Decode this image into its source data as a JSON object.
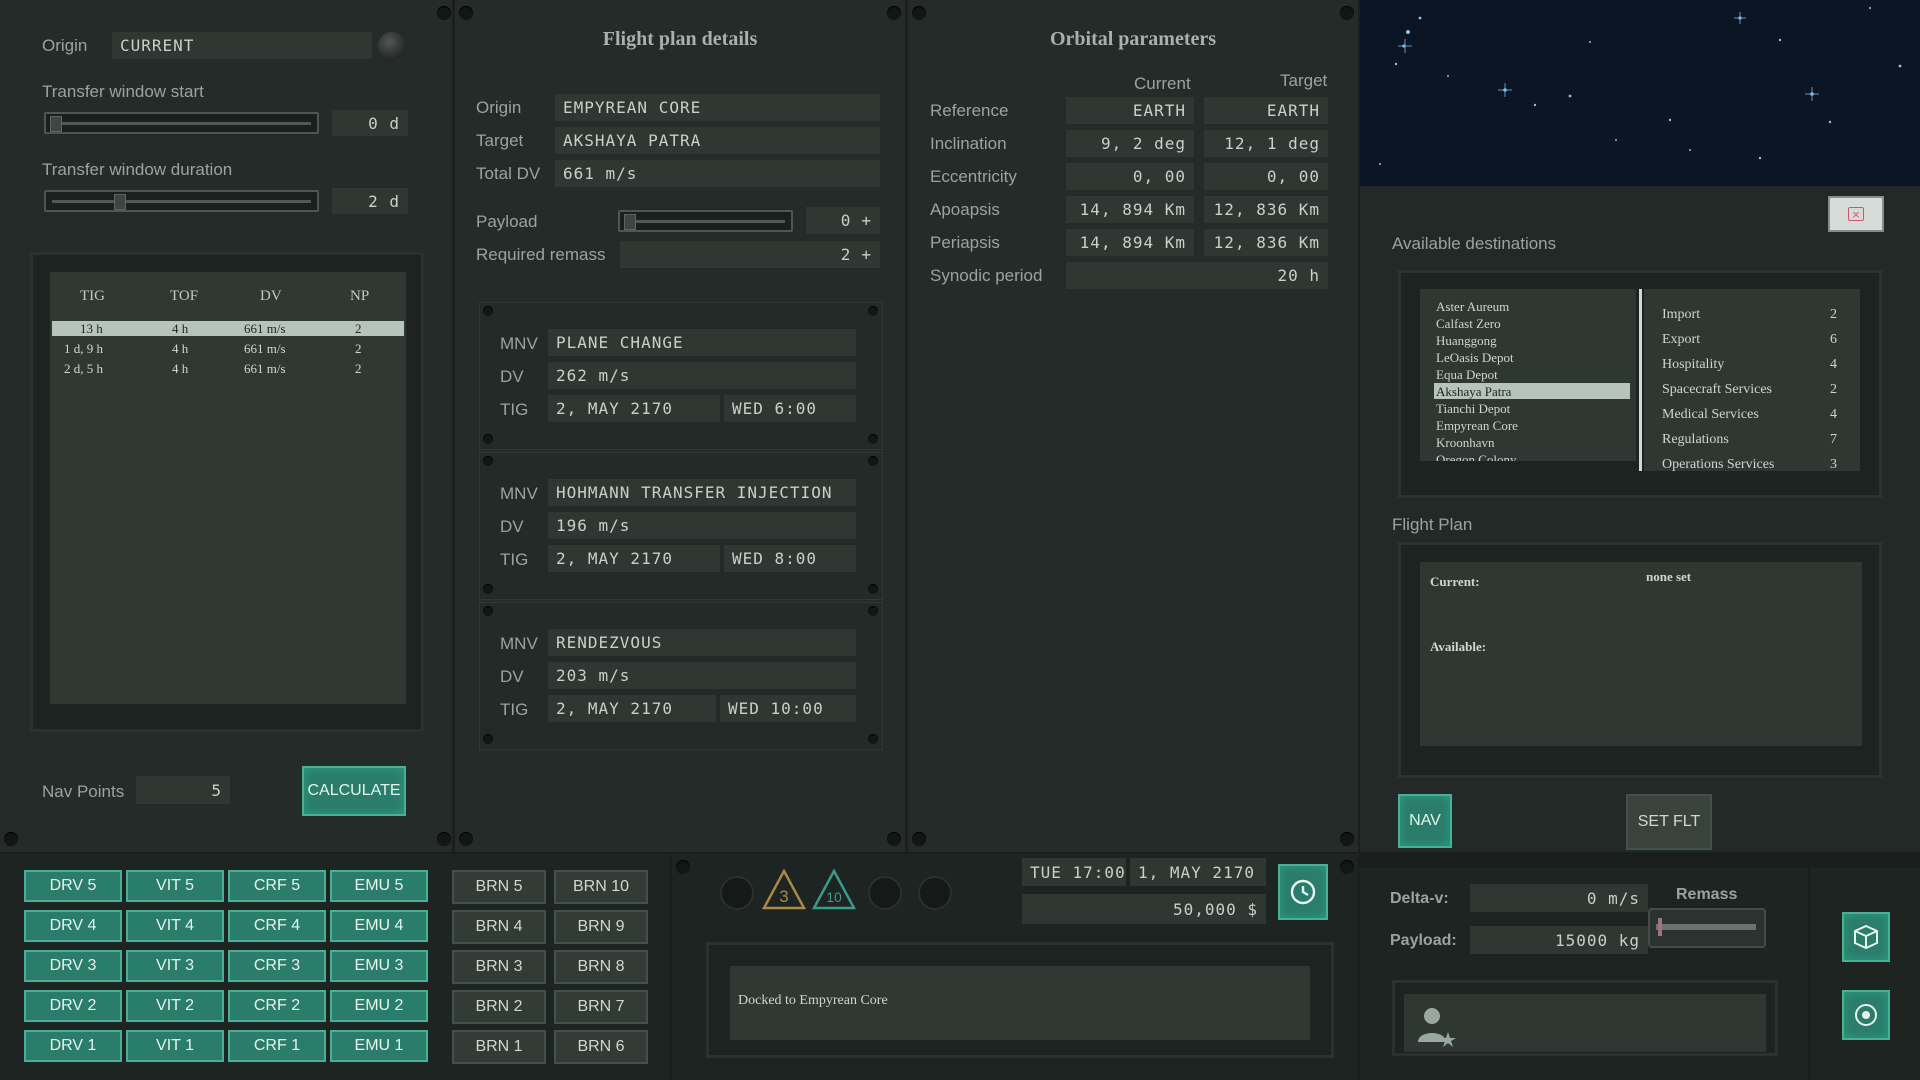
{
  "left": {
    "origin_label": "Origin",
    "origin_value": "CURRENT",
    "tw_start_label": "Transfer window start",
    "tw_start_value": "0 d",
    "tw_start_fraction": 0.0,
    "tw_duration_label": "Transfer window duration",
    "tw_duration_value": "2 d",
    "tw_duration_fraction": 0.25,
    "table": {
      "headers": [
        "TIG",
        "TOF",
        "DV",
        "NP"
      ],
      "rows": [
        [
          "13 h",
          "4 h",
          "661 m/s",
          "2"
        ],
        [
          "1 d, 9 h",
          "4 h",
          "661 m/s",
          "2"
        ],
        [
          "2 d, 5 h",
          "4 h",
          "661 m/s",
          "2"
        ]
      ]
    },
    "nav_points_label": "Nav Points",
    "nav_points_value": "5",
    "calculate_label": "CALCULATE"
  },
  "flight": {
    "title": "Flight plan details",
    "origin_label": "Origin",
    "origin_value": "EMPYREAN CORE",
    "target_label": "Target",
    "target_value": "AKSHAYA PATRA",
    "totaldv_label": "Total DV",
    "totaldv_value": "661 m/s",
    "payload_label": "Payload",
    "payload_value": "0",
    "remass_label": "Required remass",
    "remass_value": "2",
    "plus": "+",
    "maneuvers": [
      {
        "mnv_label": "MNV",
        "mnv": "PLANE CHANGE",
        "dv_label": "DV",
        "dv": "262 m/s",
        "tig_label": "TIG",
        "date": "2, MAY 2170",
        "time": "WED 6:00"
      },
      {
        "mnv_label": "MNV",
        "mnv": "HOHMANN TRANSFER INJECTION",
        "dv_label": "DV",
        "dv": "196 m/s",
        "tig_label": "TIG",
        "date": "2, MAY 2170",
        "time": "WED 8:00"
      },
      {
        "mnv_label": "MNV",
        "mnv": "RENDEZVOUS",
        "dv_label": "DV",
        "dv": "203 m/s",
        "tig_label": "TIG",
        "date": "2, MAY 2170",
        "time": "WED 10:00"
      }
    ]
  },
  "orbital": {
    "title": "Orbital parameters",
    "col_current": "Current",
    "col_target": "Target",
    "rows": [
      {
        "label": "Reference",
        "current": "EARTH",
        "target": "EARTH"
      },
      {
        "label": "Inclination",
        "current": "9, 2 deg",
        "target": "12, 1 deg"
      },
      {
        "label": "Eccentricity",
        "current": "0, 00",
        "target": "0, 00"
      },
      {
        "label": "Apoapsis",
        "current": "14, 894 Km",
        "target": "12, 836 Km"
      },
      {
        "label": "Periapsis",
        "current": "14, 894 Km",
        "target": "12, 836 Km"
      }
    ],
    "synodic_label": "Synodic period",
    "synodic_value": "20 h"
  },
  "right": {
    "dest_title": "Available destinations",
    "destinations": [
      "Aster Aureum",
      "Calfast Zero",
      "Huanggong",
      "LeOasis Depot",
      "Equa Depot",
      "Akshaya Patra",
      "Tianchi Depot",
      "Empyrean Core",
      "Kroonhavn",
      "Oregon Colony"
    ],
    "selected_index": 5,
    "services": [
      {
        "name": "Import",
        "count": "2"
      },
      {
        "name": "Export",
        "count": "6"
      },
      {
        "name": "Hospitality",
        "count": "4"
      },
      {
        "name": "Spacecraft Services",
        "count": "2"
      },
      {
        "name": "Medical Services",
        "count": "4"
      },
      {
        "name": "Regulations",
        "count": "7"
      },
      {
        "name": "Operations Services",
        "count": "3"
      }
    ],
    "flightplan_title": "Flight Plan",
    "current_label": "Current:",
    "current_value": "none set",
    "available_label": "Available:",
    "nav_label": "NAV",
    "setflt_label": "SET FLT",
    "deltav_label": "Delta-v:",
    "deltav_value": "0 m/s",
    "payload_label": "Payload:",
    "payload_value": "15000 kg",
    "remass_label": "Remass"
  },
  "bottom": {
    "drv": [
      "DRV 5",
      "DRV 4",
      "DRV 3",
      "DRV 2",
      "DRV 1"
    ],
    "vit": [
      "VIT 5",
      "VIT 4",
      "VIT 3",
      "VIT 2",
      "VIT 1"
    ],
    "crf": [
      "CRF 5",
      "CRF 4",
      "CRF 3",
      "CRF 2",
      "CRF 1"
    ],
    "emu": [
      "EMU 5",
      "EMU 4",
      "EMU 3",
      "EMU 2",
      "EMU 1"
    ],
    "brn_a": [
      "BRN 5",
      "BRN 4",
      "BRN 3",
      "BRN 2",
      "BRN 1"
    ],
    "brn_b": [
      "BRN 10",
      "BRN 9",
      "BRN 8",
      "BRN 7",
      "BRN 6"
    ],
    "badge1": "3",
    "badge2": "10",
    "clock_day": "TUE 17:00",
    "clock_date": "1, MAY 2170",
    "money": "50,000 $",
    "status_msg": "Docked to Empyrean Core"
  },
  "colors": {
    "accent_teal": "#2a7d6a",
    "selected_row": "#b7c3bd",
    "close_button": "#c9567a"
  }
}
